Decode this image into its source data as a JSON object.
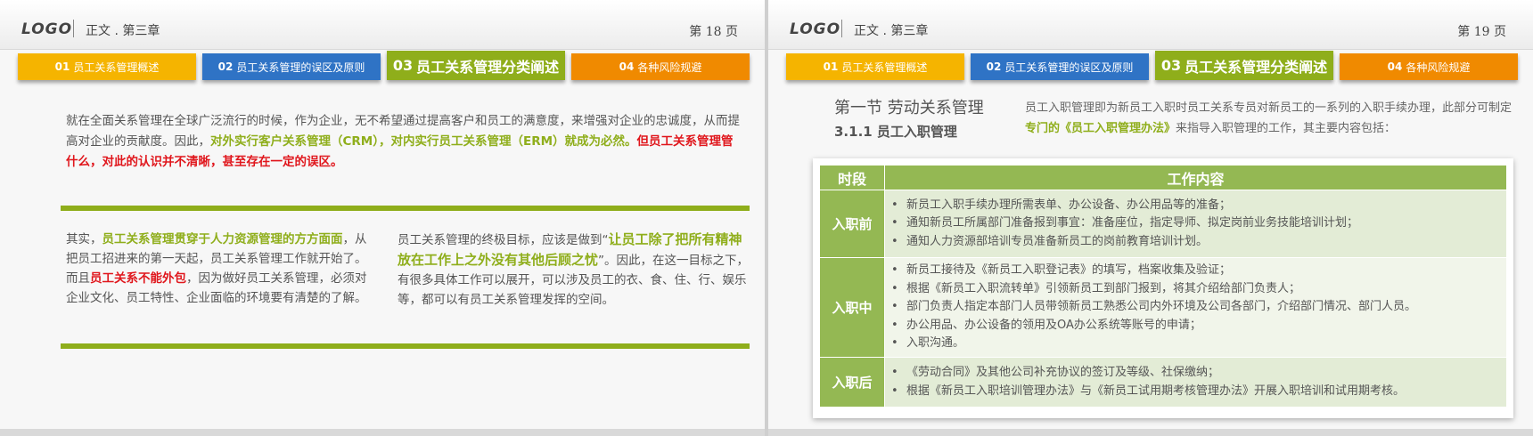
{
  "slides": [
    {
      "logo": "LOGO",
      "chapter": "正文 . 第三章",
      "page": "第 18 页",
      "tabs": [
        {
          "num": "01",
          "label": "员工关系管理概述"
        },
        {
          "num": "02",
          "label": "员工关系管理的误区及原则"
        },
        {
          "num": "03",
          "label": "员工关系管理分类阐述"
        },
        {
          "num": "04",
          "label": "各种风险规避"
        }
      ],
      "para1": {
        "a": "就在全面关系管理在全球广泛流行的时候，作为企业，无不希望通过提高客户和员工的满意度，来增强对企业的忠诚度，从而提高对企业的贡献度。因此，",
        "b": "对外实行客户关系管理（CRM），对内实行员工关系管理（ERM）就成为必然。",
        "c": "但员工关系管理管什么，对此的认识并不清晰，甚至存在一定的误区。"
      },
      "para2": {
        "a": "其实，",
        "b": "员工关系管理贯穿于人力资源管理的方方面面",
        "c": "，从把员工招进来的第一天起，员工关系管理工作就开始了。而且",
        "d": "员工关系不能外包",
        "e": "，因为做好员工关系管理，必须对企业文化、员工特性、企业面临的环境要有清楚的了解。"
      },
      "para3": {
        "a": "员工关系管理的终极目标，应该是做到“",
        "b": "让员工除了把所有精神放在工作上之外没有其他后顾之忧",
        "c": "”。因此，在这一目标之下，有很多具体工作可以展开，可以涉及员工的衣、食、住、行、娱乐等，都可以有员工关系管理发挥的空间。"
      }
    },
    {
      "logo": "LOGO",
      "chapter": "正文 . 第三章",
      "page": "第 19 页",
      "tabs": [
        {
          "num": "01",
          "label": "员工关系管理概述"
        },
        {
          "num": "02",
          "label": "员工关系管理的误区及原则"
        },
        {
          "num": "03",
          "label": "员工关系管理分类阐述"
        },
        {
          "num": "04",
          "label": "各种风险规避"
        }
      ],
      "section_title": "第一节  劳动关系管理",
      "section_sub": "3.1.1 员工入职管理",
      "intro": {
        "a": "员工入职管理即为新员工入职时员工关系专员对新员工的一系列的入职手续办理，此部分可制定",
        "b": "专门的《员工入职管理办法》",
        "c": "来指导入职管理的工作，其主要内容包括："
      },
      "table": {
        "headers": [
          "时段",
          "工作内容"
        ],
        "rows": [
          {
            "phase": "入职前",
            "items": [
              "新员工入职手续办理所需表单、办公设备、办公用品等的准备；",
              "通知新员工所属部门准备报到事宜：准备座位，指定导师、拟定岗前业务技能培训计划；",
              "通知人力资源部培训专员准备新员工的岗前教育培训计划。"
            ]
          },
          {
            "phase": "入职中",
            "items": [
              "新员工接待及《新员工入职登记表》的填写，档案收集及验证；",
              "根据《新员工入职流转单》引领新员工到部门报到，将其介绍给部门负责人；",
              "部门负责人指定本部门人员带领新员工熟悉公司内外环境及公司各部门，介绍部门情况、部门人员。",
              "办公用品、办公设备的领用及OA办公系统等账号的申请；",
              "入职沟通。"
            ]
          },
          {
            "phase": "入职后",
            "items": [
              "《劳动合同》及其他公司补充协议的签订及等级、社保缴纳；",
              "根据《新员工入职培训管理办法》与《新员工试用期考核管理办法》开展入职培训和试用期考核。"
            ]
          }
        ]
      }
    }
  ]
}
